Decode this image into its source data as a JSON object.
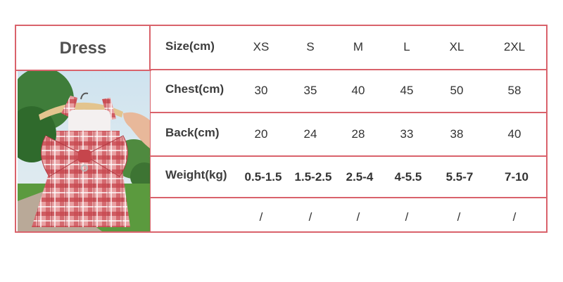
{
  "table": {
    "title": "Dress",
    "columns": [
      "XS",
      "S",
      "M",
      "L",
      "XL",
      "2XL"
    ],
    "rows": [
      {
        "label": "Size(cm)",
        "values": [
          "XS",
          "S",
          "M",
          "L",
          "XL",
          "2XL"
        ]
      },
      {
        "label": "Chest(cm)",
        "values": [
          "30",
          "35",
          "40",
          "45",
          "50",
          "58"
        ]
      },
      {
        "label": "Back(cm)",
        "values": [
          "20",
          "24",
          "28",
          "33",
          "38",
          "40"
        ]
      },
      {
        "label": "Weight(kg)",
        "values": [
          "0.5-1.5",
          "1.5-2.5",
          "2.5-4",
          "4-5.5",
          "5.5-7",
          "7-10"
        ]
      },
      {
        "label": "",
        "values": [
          "/",
          "/",
          "/",
          "/",
          "/",
          "/"
        ]
      }
    ]
  },
  "colors": {
    "border": "#d9626b",
    "text": "#3a3a3a"
  },
  "image": {
    "subject": "red plaid dog dress with bow on wooden hanger"
  }
}
